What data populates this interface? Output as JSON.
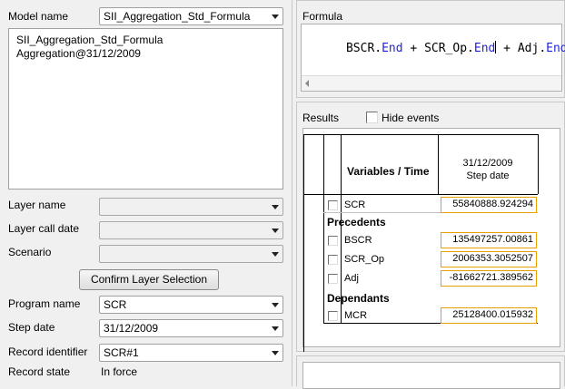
{
  "left": {
    "model_name_label": "Model name",
    "model_name_value": "SII_Aggregation_Std_Formula",
    "model_list": [
      "SII_Aggregation_Std_Formula",
      "Aggregation@31/12/2009"
    ],
    "layer_name_label": "Layer name",
    "layer_name_value": "",
    "layer_call_date_label": "Layer call date",
    "layer_call_date_value": "",
    "scenario_label": "Scenario",
    "scenario_value": "",
    "confirm_button": "Confirm Layer Selection",
    "program_name_label": "Program name",
    "program_name_value": "SCR",
    "step_date_label": "Step date",
    "step_date_value": "31/12/2009",
    "record_identifier_label": "Record identifier",
    "record_identifier_value": "SCR#1",
    "record_state_label": "Record state",
    "record_state_value": "In force"
  },
  "formula": {
    "label": "Formula",
    "tokens": [
      "BSCR",
      ".",
      "End",
      " + ",
      "SCR_Op",
      ".",
      "End",
      " + ",
      "Adj",
      ".",
      "End"
    ]
  },
  "results": {
    "label": "Results",
    "hide_events_label": "Hide events",
    "header_variables": "Variables / Time",
    "header_date": "31/12/2009",
    "header_step": "Step date",
    "main_row": {
      "name": "SCR",
      "value": "55840888.924294"
    },
    "precedents_label": "Precedents",
    "precedents": [
      {
        "name": "BSCR",
        "value": "135497257.00861"
      },
      {
        "name": "SCR_Op",
        "value": "2006353.3052507"
      },
      {
        "name": "Adj",
        "value": "-81662721.389562"
      }
    ],
    "dependants_label": "Dependants",
    "dependants": [
      {
        "name": "MCR",
        "value": "25128400.015932"
      }
    ]
  },
  "colors": {
    "keyword": "#2222dd",
    "value_border": "#e8a000",
    "window_bg": "#f0f0f0"
  },
  "icons": [
    "chevron-down-icon",
    "checkbox-icon",
    "scroll-left-icon",
    "text-cursor-icon"
  ]
}
